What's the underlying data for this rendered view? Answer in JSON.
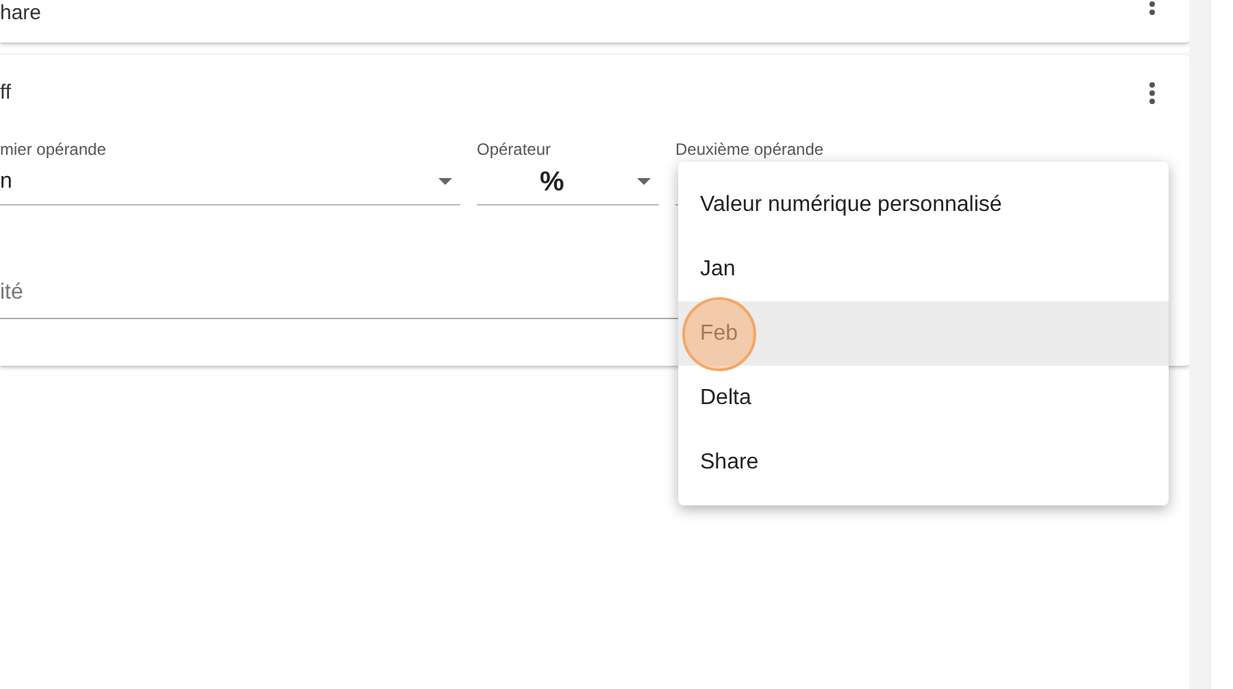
{
  "cards": [
    {
      "title": "hare"
    },
    {
      "title": "ff",
      "fields": [
        {
          "kind": "select",
          "label": "mier opérande",
          "value": "n"
        },
        {
          "kind": "select",
          "label": "Opérateur",
          "value": "%"
        },
        {
          "kind": "select",
          "label": "Deuxième opérande"
        }
      ],
      "input": {
        "placeholder": "ité"
      }
    }
  ],
  "menu": {
    "items": [
      {
        "label": "Valeur numérique personnalisé",
        "highlighted": false,
        "click_marker": false
      },
      {
        "label": "Jan",
        "highlighted": false,
        "click_marker": false
      },
      {
        "label": "Feb",
        "highlighted": true,
        "click_marker": true
      },
      {
        "label": "Delta",
        "highlighted": false,
        "click_marker": false
      },
      {
        "label": "Share",
        "highlighted": false,
        "click_marker": false
      }
    ]
  }
}
